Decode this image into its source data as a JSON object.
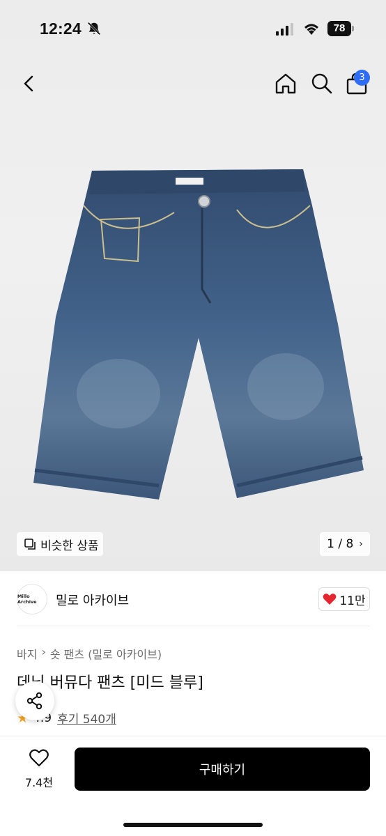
{
  "status_bar": {
    "time": "12:24",
    "battery": "78"
  },
  "nav": {
    "back_icon": "chevron-left-icon",
    "home_icon": "home-icon",
    "search_icon": "search-icon",
    "cart_icon": "bag-icon",
    "cart_badge": "3"
  },
  "gallery": {
    "similar_label": "비슷한 상품",
    "page_counter": "1 / 8"
  },
  "brand": {
    "logo_text": "Millo Archive",
    "name": "밀로 아카이브",
    "likes": "11만"
  },
  "product": {
    "breadcrumb": [
      "바지",
      "숏 팬츠 (밀로 아카이브)"
    ],
    "title": "데님 버뮤다 팬츠 [미드 블루]",
    "rating": "4.9",
    "reviews": "후기 540개"
  },
  "bottom_bar": {
    "wish_count": "7.4천",
    "buy_label": "구매하기"
  },
  "colors": {
    "accent_blue": "#2f6df6",
    "like_red": "#e3262f",
    "star": "#f5a623",
    "denim": "#3e5a7e"
  }
}
